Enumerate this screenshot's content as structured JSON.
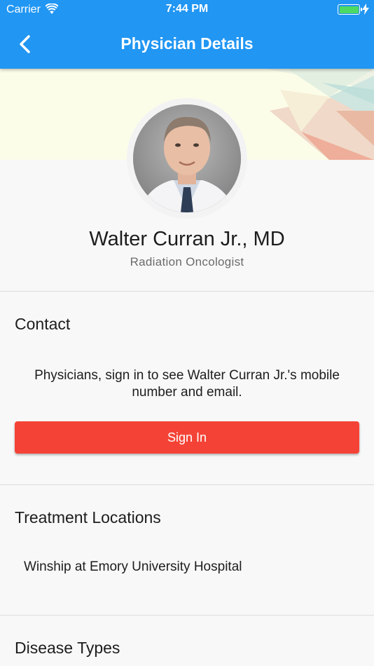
{
  "status_bar": {
    "carrier": "Carrier",
    "time": "7:44 PM",
    "battery_color": "#4cd964"
  },
  "app_bar": {
    "title": "Physician Details",
    "back_icon": "chevron-left-icon",
    "color": "#2196f3"
  },
  "profile": {
    "name": "Walter Curran Jr., MD",
    "specialty": "Radiation Oncologist"
  },
  "contact": {
    "heading": "Contact",
    "message": "Physicians, sign in to see Walter Curran Jr.'s mobile number and email.",
    "sign_in_label": "Sign In",
    "button_color": "#f44336"
  },
  "treatment_locations": {
    "heading": "Treatment Locations",
    "items": [
      "Winship at Emory University Hospital"
    ]
  },
  "disease_types": {
    "heading": "Disease Types"
  }
}
